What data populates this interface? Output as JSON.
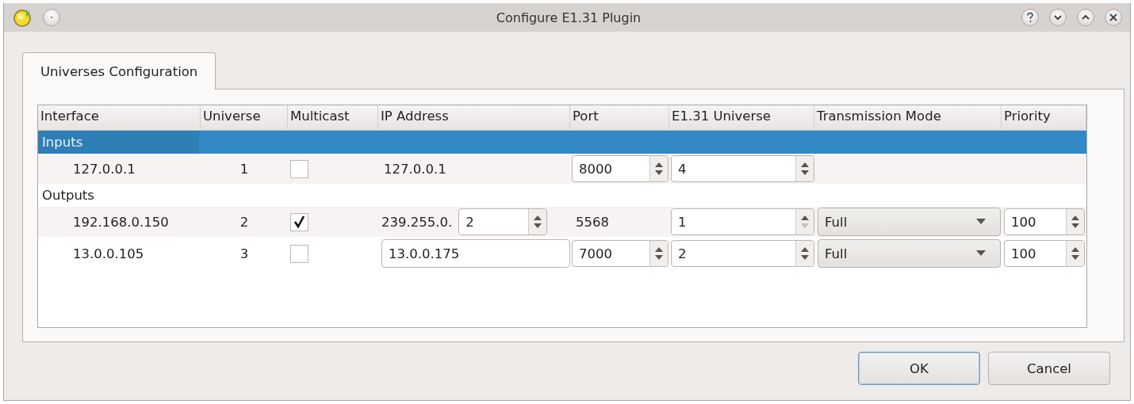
{
  "window": {
    "title": "Configure E1.31 Plugin"
  },
  "tabs": [
    {
      "label": "Universes Configuration",
      "selected": true
    }
  ],
  "table": {
    "columns": [
      "Interface",
      "Universe",
      "Multicast",
      "IP Address",
      "Port",
      "E1.31 Universe",
      "Transmission Mode",
      "Priority"
    ],
    "rows": [
      {
        "kind": "group",
        "label": "Inputs",
        "selected": true
      },
      {
        "kind": "entry",
        "interface": "127.0.0.1",
        "universe": "1",
        "multicast": false,
        "ip": {
          "kind": "text",
          "value": "127.0.0.1"
        },
        "port": {
          "kind": "spin",
          "value": "8000"
        },
        "e131_universe": {
          "value": "4",
          "at_minimum": false
        }
      },
      {
        "kind": "group",
        "label": "Outputs",
        "selected": false
      },
      {
        "kind": "entry",
        "interface": "192.168.0.150",
        "universe": "2",
        "multicast": true,
        "ip": {
          "kind": "prefix-spin",
          "prefix": "239.255.0.",
          "value": "2"
        },
        "port": {
          "kind": "text",
          "value": "5568"
        },
        "e131_universe": {
          "value": "1",
          "at_minimum": true
        },
        "transmission_mode": "Full",
        "priority": "100"
      },
      {
        "kind": "entry",
        "interface": "13.0.0.105",
        "universe": "3",
        "multicast": false,
        "ip": {
          "kind": "field",
          "value": "13.0.0.175"
        },
        "port": {
          "kind": "spin",
          "value": "7000"
        },
        "e131_universe": {
          "value": "2",
          "at_minimum": false
        },
        "transmission_mode": "Full",
        "priority": "100"
      }
    ]
  },
  "buttons": [
    {
      "label": "OK",
      "default": true
    },
    {
      "label": "Cancel",
      "default": false
    }
  ]
}
